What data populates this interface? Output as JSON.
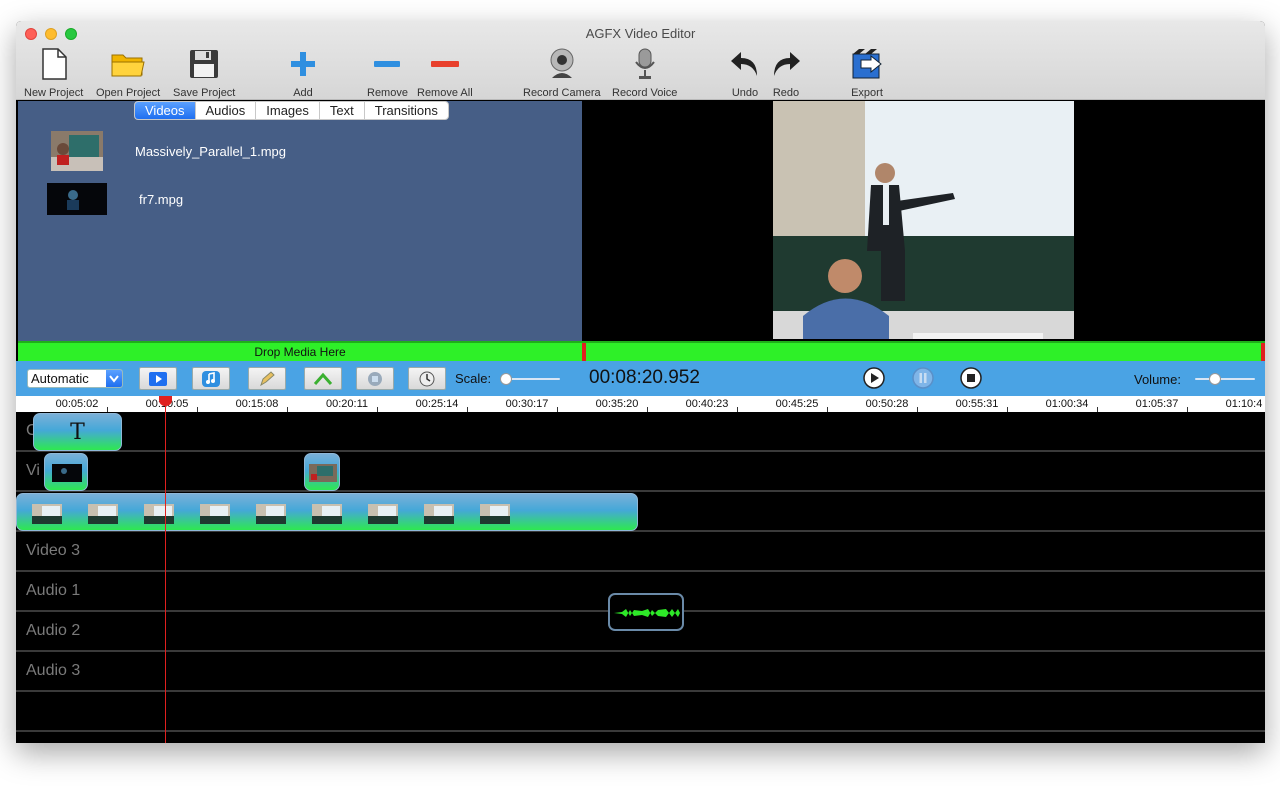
{
  "window": {
    "title": "AGFX Video Editor"
  },
  "toolbar": [
    {
      "id": "new",
      "label": "New Project",
      "icon": "new-document-icon"
    },
    {
      "id": "open",
      "label": "Open Project",
      "icon": "folder-icon"
    },
    {
      "id": "save",
      "label": "Save Project",
      "icon": "floppy-disk-icon"
    },
    {
      "id": "add",
      "label": "Add",
      "icon": "plus-icon"
    },
    {
      "id": "remove",
      "label": "Remove",
      "icon": "minus-icon"
    },
    {
      "id": "remove_all",
      "label": "Remove All",
      "icon": "remove-all-icon"
    },
    {
      "id": "record_camera",
      "label": "Record Camera",
      "icon": "webcam-icon"
    },
    {
      "id": "record_voice",
      "label": "Record Voice",
      "icon": "microphone-icon"
    },
    {
      "id": "undo",
      "label": "Undo",
      "icon": "undo-arrow-icon"
    },
    {
      "id": "redo",
      "label": "Redo",
      "icon": "redo-arrow-icon"
    },
    {
      "id": "export",
      "label": "Export",
      "icon": "export-icon"
    }
  ],
  "media_tabs": [
    {
      "label": "Videos",
      "active": true
    },
    {
      "label": "Audios",
      "active": false
    },
    {
      "label": "Images",
      "active": false
    },
    {
      "label": "Text",
      "active": false
    },
    {
      "label": "Transitions",
      "active": false
    }
  ],
  "media_items": [
    {
      "name": "Massively_Parallel_1.mpg"
    },
    {
      "name": "fr7.mpg"
    }
  ],
  "drop_zone": {
    "label": "Drop Media Here"
  },
  "controls": {
    "mode": "Automatic",
    "scale_label": "Scale:",
    "timecode": "00:08:20.952",
    "volume_label": "Volume:",
    "tools": [
      "video-track-icon",
      "music-note-icon",
      "pencil-icon",
      "transition-arrows-icon",
      "record-icon",
      "clock-icon"
    ]
  },
  "ruler": {
    "labels": [
      "00:05:02",
      "00:10:05",
      "00:15:08",
      "00:20:11",
      "00:25:14",
      "00:30:17",
      "00:35:20",
      "00:40:23",
      "00:45:25",
      "00:50:28",
      "00:55:31",
      "01:00:34",
      "01:05:37",
      "01:10:4"
    ]
  },
  "tracks": [
    {
      "label": "C"
    },
    {
      "label": "Vi"
    },
    {
      "label": ""
    },
    {
      "label": "Video 3"
    },
    {
      "label": "Audio 1"
    },
    {
      "label": "Audio 2"
    },
    {
      "label": "Audio 3"
    }
  ],
  "text_clip": {
    "label": "T"
  }
}
